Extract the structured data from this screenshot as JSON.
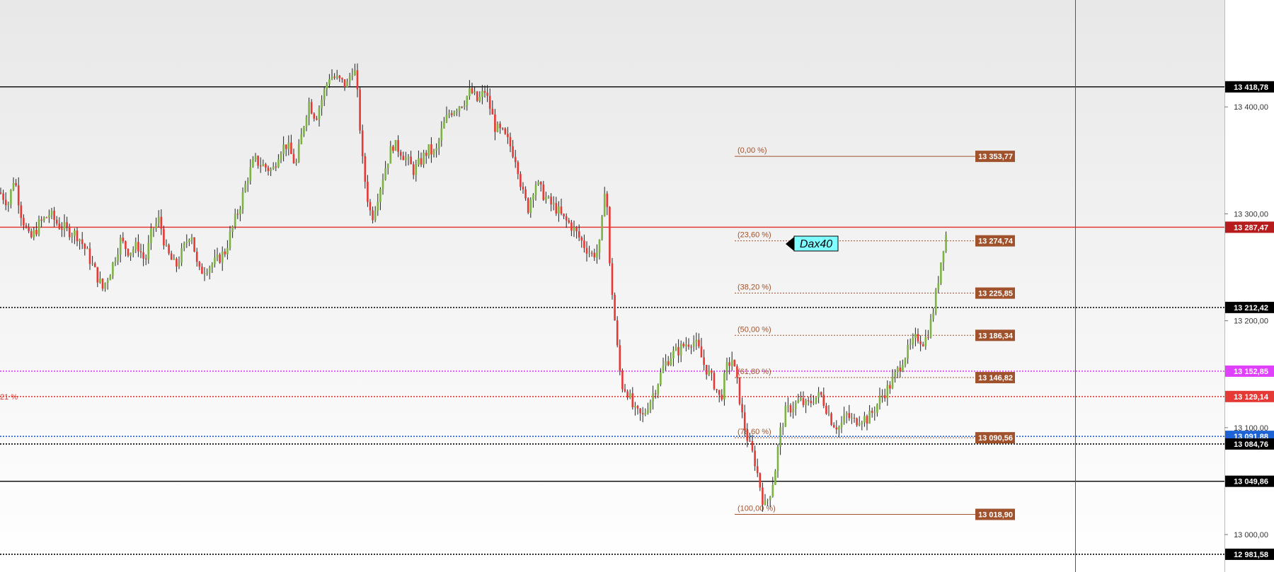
{
  "chart_data": {
    "type": "candlestick",
    "symbol_label": "Dax40",
    "ylim": [
      12965,
      13500
    ],
    "y_ticks": [
      {
        "value": 13400,
        "label": "13 400,00"
      },
      {
        "value": 13300,
        "label": "13 300,00"
      },
      {
        "value": 13200,
        "label": "13 200,00"
      },
      {
        "value": 13100,
        "label": "13 100,00"
      },
      {
        "value": 13000,
        "label": "13 000,00"
      }
    ],
    "horizontal_levels": [
      {
        "value": 13418.78,
        "label": "13 418,78",
        "style": "solid",
        "color": "#000000",
        "badge_bg": "#000000",
        "badge_fg": "#ffffff"
      },
      {
        "value": 13287.47,
        "label": "13 287,47",
        "style": "solid",
        "color": "#e53935",
        "badge_bg": "#b71c1c",
        "badge_fg": "#ffffff"
      },
      {
        "value": 13212.42,
        "label": "13 212,42",
        "style": "dotted",
        "color": "#000000",
        "badge_bg": "#000000",
        "badge_fg": "#ffffff"
      },
      {
        "value": 13152.85,
        "label": "13 152,85",
        "style": "dotted",
        "color": "#e040fb",
        "badge_bg": "#e040fb",
        "badge_fg": "#ffffff"
      },
      {
        "value": 13129.14,
        "label": "13 129,14",
        "style": "dotted",
        "color": "#e53935",
        "badge_bg": "#e53935",
        "badge_fg": "#ffffff",
        "left_label": "21 %"
      },
      {
        "value": 13091.88,
        "label": "13 091,88",
        "style": "dotted",
        "color": "#1e63d6",
        "badge_bg": "#1e63d6",
        "badge_fg": "#ffffff"
      },
      {
        "value": 13084.76,
        "label": "13 084,76",
        "style": "dotted",
        "color": "#000000",
        "badge_bg": "#000000",
        "badge_fg": "#ffffff"
      },
      {
        "value": 13049.86,
        "label": "13 049,86",
        "style": "solid",
        "color": "#000000",
        "badge_bg": "#000000",
        "badge_fg": "#ffffff"
      },
      {
        "value": 12981.58,
        "label": "12 981,58",
        "style": "dotted",
        "color": "#000000",
        "badge_bg": "#000000",
        "badge_fg": "#ffffff"
      }
    ],
    "fibonacci": [
      {
        "pct": "(0,00 %)",
        "value": 13353.77,
        "label": "13 353,77"
      },
      {
        "pct": "(23,60 %)",
        "value": 13274.74,
        "label": "13 274,74"
      },
      {
        "pct": "(38,20 %)",
        "value": 13225.85,
        "label": "13 225,85"
      },
      {
        "pct": "(50,00 %)",
        "value": 13186.34,
        "label": "13 186,34"
      },
      {
        "pct": "(61,80 %)",
        "value": 13146.82,
        "label": "13 146,82"
      },
      {
        "pct": "(78,60 %)",
        "value": 13090.56,
        "label": "13 090,56"
      },
      {
        "pct": "(100,00 %)",
        "value": 13018.9,
        "label": "13 018,90"
      }
    ],
    "price_path": [
      [
        0,
        13320
      ],
      [
        12,
        13310
      ],
      [
        20,
        13335
      ],
      [
        30,
        13300
      ],
      [
        42,
        13275
      ],
      [
        55,
        13290
      ],
      [
        70,
        13300
      ],
      [
        82,
        13290
      ],
      [
        95,
        13285
      ],
      [
        110,
        13280
      ],
      [
        122,
        13265
      ],
      [
        135,
        13245
      ],
      [
        145,
        13230
      ],
      [
        158,
        13250
      ],
      [
        170,
        13275
      ],
      [
        182,
        13265
      ],
      [
        195,
        13270
      ],
      [
        205,
        13255
      ],
      [
        215,
        13285
      ],
      [
        225,
        13295
      ],
      [
        235,
        13265
      ],
      [
        248,
        13250
      ],
      [
        258,
        13265
      ],
      [
        270,
        13285
      ],
      [
        280,
        13245
      ],
      [
        292,
        13250
      ],
      [
        305,
        13255
      ],
      [
        318,
        13265
      ],
      [
        330,
        13290
      ],
      [
        340,
        13310
      ],
      [
        350,
        13335
      ],
      [
        360,
        13350
      ],
      [
        372,
        13345
      ],
      [
        385,
        13340
      ],
      [
        395,
        13360
      ],
      [
        405,
        13365
      ],
      [
        418,
        13345
      ],
      [
        428,
        13380
      ],
      [
        436,
        13405
      ],
      [
        446,
        13390
      ],
      [
        456,
        13410
      ],
      [
        466,
        13430
      ],
      [
        478,
        13425
      ],
      [
        490,
        13420
      ],
      [
        500,
        13440
      ],
      [
        506,
        13405
      ],
      [
        512,
        13350
      ],
      [
        518,
        13320
      ],
      [
        525,
        13295
      ],
      [
        535,
        13320
      ],
      [
        545,
        13345
      ],
      [
        555,
        13365
      ],
      [
        565,
        13360
      ],
      [
        575,
        13350
      ],
      [
        585,
        13340
      ],
      [
        595,
        13350
      ],
      [
        605,
        13360
      ],
      [
        615,
        13355
      ],
      [
        625,
        13380
      ],
      [
        635,
        13395
      ],
      [
        645,
        13400
      ],
      [
        655,
        13405
      ],
      [
        665,
        13415
      ],
      [
        675,
        13405
      ],
      [
        685,
        13415
      ],
      [
        692,
        13400
      ],
      [
        700,
        13380
      ],
      [
        710,
        13375
      ],
      [
        720,
        13365
      ],
      [
        730,
        13350
      ],
      [
        738,
        13320
      ],
      [
        746,
        13305
      ],
      [
        756,
        13330
      ],
      [
        766,
        13320
      ],
      [
        776,
        13310
      ],
      [
        786,
        13305
      ],
      [
        796,
        13295
      ],
      [
        806,
        13290
      ],
      [
        816,
        13280
      ],
      [
        826,
        13270
      ],
      [
        836,
        13262
      ],
      [
        846,
        13265
      ],
      [
        852,
        13300
      ],
      [
        856,
        13345
      ],
      [
        860,
        13260
      ],
      [
        866,
        13220
      ],
      [
        872,
        13175
      ],
      [
        878,
        13140
      ],
      [
        886,
        13135
      ],
      [
        896,
        13115
      ],
      [
        908,
        13110
      ],
      [
        918,
        13125
      ],
      [
        928,
        13140
      ],
      [
        938,
        13158
      ],
      [
        948,
        13168
      ],
      [
        958,
        13172
      ],
      [
        968,
        13178
      ],
      [
        978,
        13182
      ],
      [
        986,
        13175
      ],
      [
        994,
        13160
      ],
      [
        1002,
        13150
      ],
      [
        1010,
        13140
      ],
      [
        1018,
        13125
      ],
      [
        1026,
        13155
      ],
      [
        1034,
        13165
      ],
      [
        1042,
        13140
      ],
      [
        1050,
        13105
      ],
      [
        1058,
        13085
      ],
      [
        1066,
        13070
      ],
      [
        1074,
        13045
      ],
      [
        1080,
        13025
      ],
      [
        1086,
        13035
      ],
      [
        1094,
        13055
      ],
      [
        1102,
        13095
      ],
      [
        1110,
        13115
      ],
      [
        1120,
        13120
      ],
      [
        1130,
        13125
      ],
      [
        1140,
        13120
      ],
      [
        1150,
        13128
      ],
      [
        1160,
        13130
      ],
      [
        1168,
        13118
      ],
      [
        1176,
        13105
      ],
      [
        1186,
        13100
      ],
      [
        1196,
        13112
      ],
      [
        1206,
        13105
      ],
      [
        1216,
        13110
      ],
      [
        1226,
        13108
      ],
      [
        1236,
        13118
      ],
      [
        1246,
        13130
      ],
      [
        1256,
        13138
      ],
      [
        1266,
        13150
      ],
      [
        1276,
        13165
      ],
      [
        1286,
        13175
      ],
      [
        1296,
        13185
      ],
      [
        1306,
        13180
      ],
      [
        1314,
        13195
      ],
      [
        1320,
        13215
      ],
      [
        1326,
        13240
      ],
      [
        1332,
        13268
      ],
      [
        1338,
        13284
      ]
    ]
  },
  "colors": {
    "bull": "#7cb342",
    "bear": "#e53935",
    "wick": "#222222",
    "fib_line": "#a0522d",
    "fib_badge": "#a0522d",
    "symbol_label_bg": "#7fffff"
  }
}
